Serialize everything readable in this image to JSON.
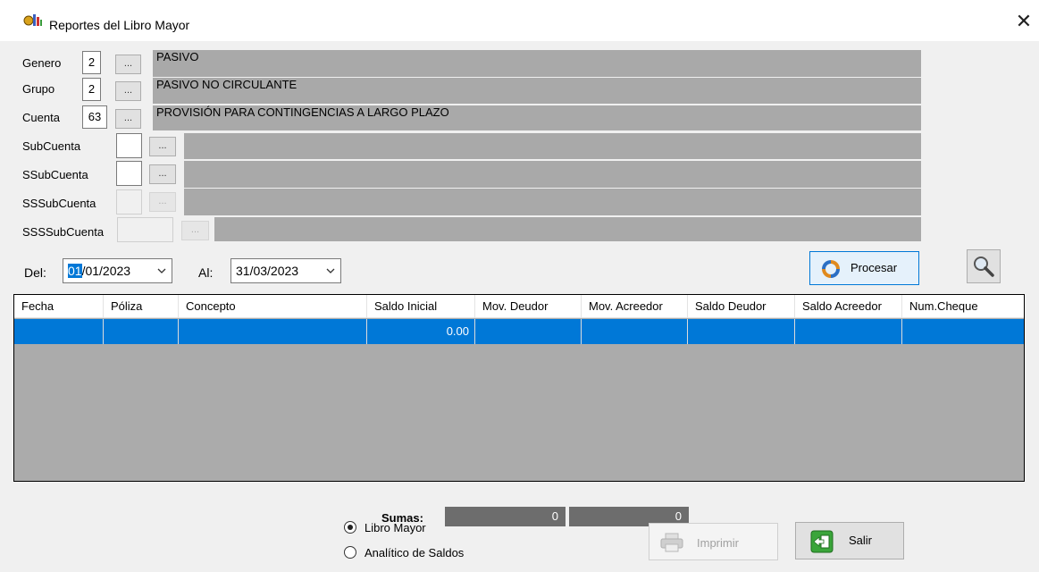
{
  "window": {
    "title": "Reportes del Libro Mayor",
    "close_glyph": "✕"
  },
  "fields": {
    "genero": {
      "label": "Genero",
      "code": "2",
      "browse": "...",
      "name": "PASIVO"
    },
    "grupo": {
      "label": "Grupo",
      "code": "2",
      "browse": "...",
      "name": "PASIVO NO CIRCULANTE"
    },
    "cuenta": {
      "label": "Cuenta",
      "code": "63",
      "browse": "...",
      "name": "PROVISIÓN PARA CONTINGENCIAS A LARGO PLAZO"
    },
    "subcuenta": {
      "label": "SubCuenta",
      "code": "",
      "browse": "...",
      "name": ""
    },
    "ssubcuenta": {
      "label": "SSubCuenta",
      "code": "",
      "browse": "...",
      "name": ""
    },
    "sssubcuenta": {
      "label": "SSSubCuenta",
      "code": "",
      "browse": "...",
      "name": ""
    },
    "ssssubcuenta": {
      "label": "SSSSubCuenta",
      "code": "",
      "browse": "...",
      "name": ""
    }
  },
  "dates": {
    "del_label": "Del:",
    "del_selected": "01",
    "del_rest": "/01/2023",
    "al_label": "Al:",
    "al_value": "31/03/2023"
  },
  "buttons": {
    "procesar": "Procesar",
    "imprimir": "Imprimir",
    "salir": "Salir"
  },
  "grid": {
    "columns": [
      "Fecha",
      "Póliza",
      "Concepto",
      "Saldo Inicial",
      "Mov. Deudor",
      "Mov. Acreedor",
      "Saldo Deudor",
      "Saldo Acreedor",
      "Num.Cheque"
    ],
    "row": {
      "saldo_inicial": "0.00"
    }
  },
  "sumas": {
    "label": "Sumas:",
    "deudor": "0",
    "acreedor": "0"
  },
  "report_type": {
    "libro_mayor": "Libro Mayor",
    "analitico": "Analítico de Saldos",
    "selected": "libro_mayor"
  },
  "colors": {
    "accent": "#0078d7",
    "name_bar": "#a9a9a9",
    "grid_bg": "#ababab",
    "sum_bg": "#6d6d6d"
  }
}
